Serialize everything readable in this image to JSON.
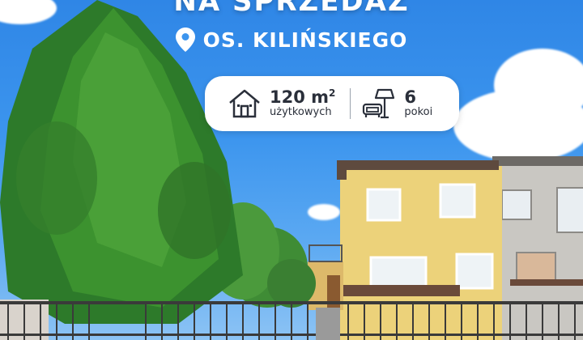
{
  "headline": "NA SPRZEDAŻ",
  "location": {
    "icon": "map-pin-icon",
    "label": "OS. KILIŃSKIEGO"
  },
  "stats": [
    {
      "icon": "house-icon",
      "value": "120 m",
      "sup": "2",
      "unit": "użytkowych"
    },
    {
      "icon": "sofa-lamp-icon",
      "value": "6",
      "unit": "pokoi"
    }
  ],
  "colors": {
    "sky": "#3c95ee",
    "facade": "#ecd27a",
    "tree": "#2d7a2a",
    "pill": "#ffffff"
  }
}
